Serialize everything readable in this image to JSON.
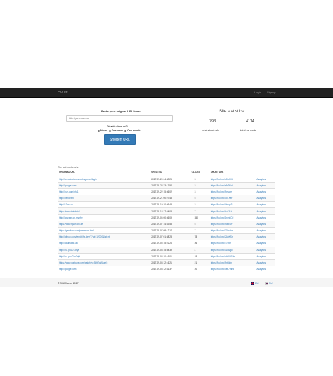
{
  "navbar": {
    "brand": "Home",
    "login": "Login",
    "signup": "Signup"
  },
  "form": {
    "paste_label": "Paste your original URL here:",
    "input_placeholder": "http://youtube.com",
    "disable_label": "Disable short url?",
    "radios": [
      {
        "label": "Never",
        "checked": true
      },
      {
        "label": "One week",
        "checked": false
      },
      {
        "label": "One month",
        "checked": false
      }
    ],
    "button_label": "Shorten URL"
  },
  "stats": {
    "title": "Site statistics:",
    "total_short_urls": "793",
    "total_url_visits": "4114",
    "short_urls_caption": "total short urls",
    "url_visits_caption": "total url visits"
  },
  "table": {
    "caption": "The last public urls:",
    "headers": [
      "ORIGINAL URL",
      "CREATED",
      "CLICKS",
      "SHORT URL",
      ""
    ],
    "rows": [
      [
        "http://www.test.com/lordragonwolfagin",
        "2017-09-24 04:40:25",
        "3",
        "https://bul.pro/s9fo0Hb",
        "Analytics"
      ],
      [
        "http://google.com",
        "2017-09-22 23:17:54",
        "3",
        "https://bul.pro/s5r7f0d",
        "Analytics"
      ],
      [
        "http://bun.com/hh-1",
        "2017-09-22 15:56:02",
        "3",
        "https://bul.pro/Rescre",
        "Analytics"
      ],
      [
        "http://yandex.ru",
        "2017-09-21 00:27:48",
        "5",
        "https://bul.pro/0dTXer",
        "Analytics"
      ],
      [
        "http://13bsc.ru",
        "2017-09-19 10:56:43",
        "3",
        "https://bul.pro/Lbxqo3",
        "Analytics"
      ],
      [
        "https://www.twitch.tv/",
        "2017-09-18 17:04:03",
        "7",
        "https://bul.pro/hu131t",
        "Analytics"
      ],
      [
        "http://wazzan.cn.nn/nfzr",
        "2017-09-06 00:56:09",
        "350",
        "https://bul.pro/Dxln6Q2",
        "Analytics"
      ],
      [
        "https://www.sparrabo.de",
        "2017-09-07 14:53:58",
        "5",
        "https://bul.pro/m4wLrr",
        "Analytics"
      ],
      [
        "https://gaelticro.com/pasrm-ne.html",
        "2017-09-07 08:12:17",
        "7",
        "https://bul.pro/37mahn",
        "Analytics"
      ],
      [
        "http://github.com/remixt/fix-dev/??n#=12000&list=rb",
        "2017-09-07 01:58:23",
        "78",
        "https://bul.pro/2ApKSn",
        "Analytics"
      ],
      [
        "http://forumauto.au",
        "2017-09-05 15:22:26",
        "26",
        "https://bul.pro/T7eikr",
        "Analytics"
      ],
      [
        "http://bul.pro/073rlyt",
        "2017-09-03 15:08:39",
        "4",
        "https://bul.pro/11Idvgc",
        "Analytics"
      ],
      [
        "http://bul.pro/07n3rlyt",
        "2017-09-03 10:16:01",
        "18",
        "https://bul.pro/d4OGEob",
        "Analytics"
      ],
      [
        "https://www.youtube.com/watch?v=5kftZpWAsYg",
        "2017-09-03 12:16:21",
        "21",
        "https://bul.pro/Prt5ldn",
        "Analytics"
      ],
      [
        "http://google.com",
        "2017-09-03 12:41:37",
        "20",
        "https://bul.pro/0ek7mhd",
        "Analytics"
      ]
    ]
  },
  "footer": {
    "copyright": "© SIAMfactor 2017",
    "lang_en": "EN",
    "lang_ru": "RU"
  }
}
